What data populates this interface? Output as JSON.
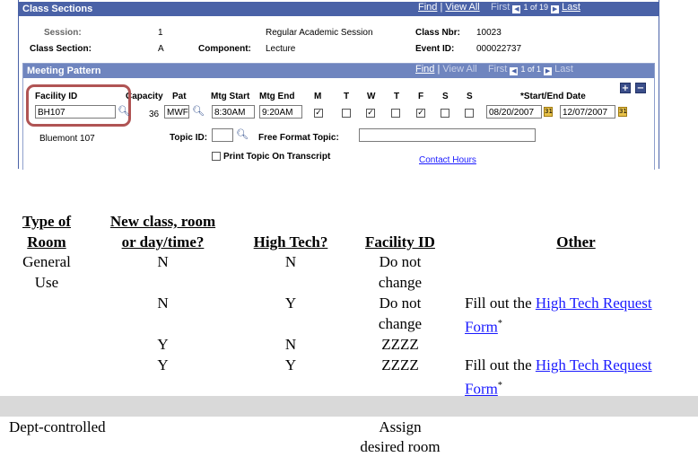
{
  "class_sections": {
    "title": "Class Sections",
    "nav": {
      "find": "Find",
      "view_all": "View All",
      "first": "First",
      "page": "1 of 19",
      "last": "Last"
    },
    "session_label": "Session:",
    "session_value": "1",
    "session_desc": "Regular Academic Session",
    "class_nbr_label": "Class Nbr:",
    "class_nbr_value": "10023",
    "class_section_label": "Class Section:",
    "class_section_value": "A",
    "component_label": "Component:",
    "component_value": "Lecture",
    "event_id_label": "Event ID:",
    "event_id_value": "000022737"
  },
  "meeting_pattern": {
    "title": "Meeting Pattern",
    "nav": {
      "find": "Find",
      "view_all": "View All",
      "first": "First",
      "page": "1 of 1",
      "last": "Last"
    },
    "headers": {
      "facility_id": "Facility ID",
      "capacity": "Capacity",
      "pat": "Pat",
      "mtg_start": "Mtg Start",
      "mtg_end": "Mtg End",
      "m": "M",
      "t1": "T",
      "w": "W",
      "t2": "T",
      "f": "F",
      "s1": "S",
      "s2": "S",
      "start_end_date": "*Start/End Date"
    },
    "facility_id_value": "BH107",
    "capacity_value": "36",
    "pat_value": "MWF",
    "mtg_start_value": "8:30AM",
    "mtg_end_value": "9:20AM",
    "days_checked": {
      "m": true,
      "t1": false,
      "w": true,
      "t2": false,
      "f": true,
      "s1": false,
      "s2": false
    },
    "start_date": "08/20/2007",
    "end_date": "12/07/2007",
    "facility_desc": "Bluemont 107",
    "topic_id_label": "Topic ID:",
    "free_format_topic_label": "Free Format Topic:",
    "print_topic_label": "Print Topic On Transcript",
    "contact_hours_link": "Contact Hours",
    "add_symbol": "+",
    "remove_symbol": "−"
  },
  "table": {
    "headers": {
      "type_line1": "Type of",
      "type_line2": "Room",
      "new_line1": "New class, room",
      "new_line2": "or day/time?",
      "high_tech": "High Tech?",
      "facility_id": "Facility ID",
      "other": "Other"
    },
    "rows": [
      {
        "type_line1": "General",
        "type_line2": "Use",
        "new": "N",
        "high_tech": "N",
        "fac_line1": "Do not",
        "fac_line2": "change",
        "other_prefix": "",
        "other_link_line1": "",
        "other_link_line2": ""
      },
      {
        "new": "N",
        "high_tech": "Y",
        "fac_line1": "Do not",
        "fac_line2": "change",
        "other_prefix": "Fill out the",
        "other_link_line1": "High Tech Request",
        "other_link_line2": "Form"
      },
      {
        "new": "Y",
        "high_tech": "N",
        "fac_line1": "ZZZZ"
      },
      {
        "new": "Y",
        "high_tech": "Y",
        "fac_line1": "ZZZZ",
        "other_prefix": "Fill out the",
        "other_link_line1": "High Tech Request",
        "other_link_line2": "Form"
      }
    ],
    "footnote_mark": "*",
    "dept": {
      "type": "Dept-controlled",
      "fac_line1": "Assign",
      "fac_line2": "desired room"
    }
  }
}
